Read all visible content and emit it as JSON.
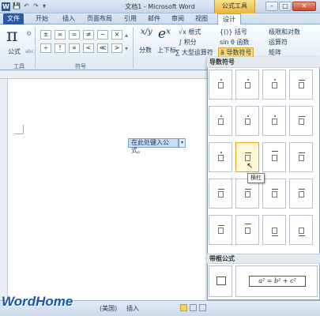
{
  "window": {
    "title": "文档1 - Microsoft Word",
    "contextual_tab_group": "公式工具",
    "app_icon": "W",
    "qat": {
      "save": "💾",
      "undo": "↶",
      "redo": "↷",
      "more": "▾"
    },
    "controls": {
      "minimize": "–",
      "maximize": "□",
      "close": "✕"
    }
  },
  "tabs": [
    "文件",
    "开始",
    "插入",
    "页面布局",
    "引用",
    "邮件",
    "审阅",
    "视图",
    "设计"
  ],
  "ribbon": {
    "tools_group": {
      "label": "工具",
      "equation_symbol": "π",
      "equation_label": "公式",
      "small_icons": [
        "⚙",
        "abc"
      ]
    },
    "symbols_group": {
      "label": "符号",
      "row1": [
        "±",
        "∞",
        "=",
        "≠",
        "~",
        "×"
      ],
      "row2": [
        "÷",
        "!",
        "∝",
        "<",
        "≪",
        ">"
      ]
    },
    "structures": {
      "fraction_symbol": "x/y",
      "fraction_label": "分数",
      "script_symbol": "eˣ",
      "script_label": "上下标",
      "radical": "√x 根式",
      "integral": "∫ 积分",
      "large_operator": "∑ 大型运算符",
      "bracket": "{()} 括号",
      "function": "sin θ 函数",
      "accent": "ä 导数符号",
      "limit": "极限和对数",
      "operator": "运算符",
      "matrix": "矩阵"
    }
  },
  "gallery": {
    "section1_title": "导数符号",
    "section2_title": "带框公式",
    "tooltip": "横杠",
    "boxed_formula": "a² = b² + c²"
  },
  "document": {
    "equation_placeholder": "在此处键入公式。",
    "equation_dropdown": "▾"
  },
  "status_bar": {
    "language": "(美国)",
    "mode": "插入"
  },
  "watermark": "WordHome"
}
